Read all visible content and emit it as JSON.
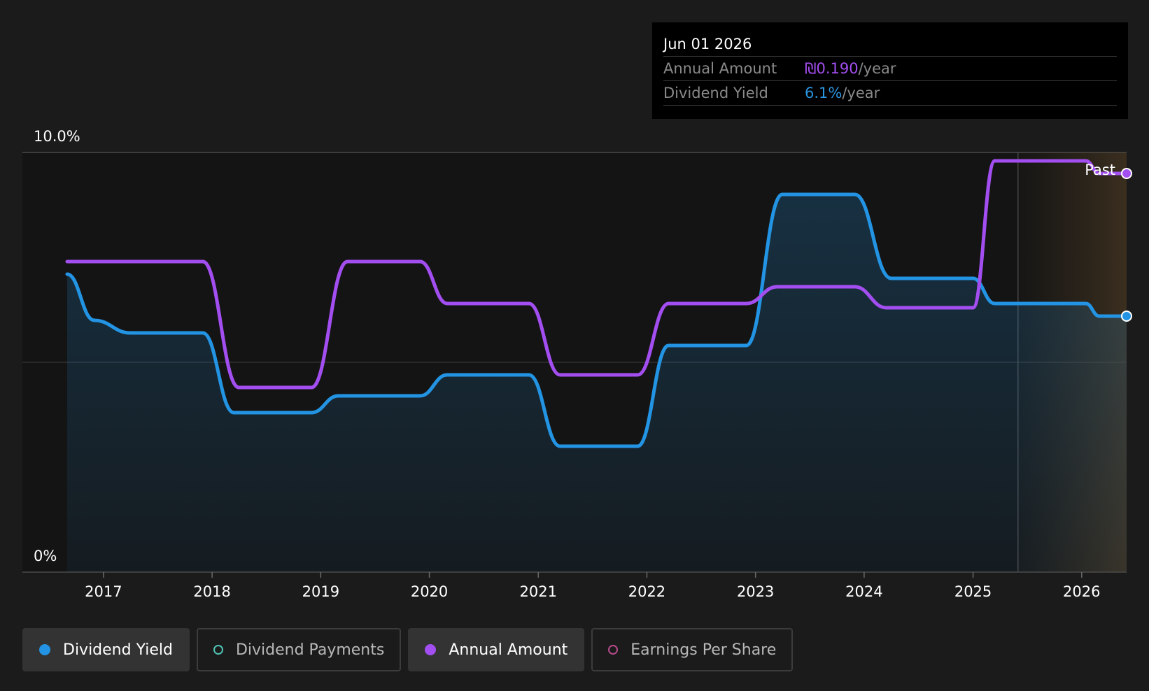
{
  "tooltip": {
    "date": "Jun 01 2026",
    "rows": [
      {
        "label": "Annual Amount",
        "value": "₪0.190",
        "unit": "/year",
        "color": "#a34ef0"
      },
      {
        "label": "Dividend Yield",
        "value": "6.1%",
        "unit": "/year",
        "color": "#2b95e0"
      }
    ]
  },
  "legend": [
    {
      "label": "Dividend Yield",
      "color": "#2394e3",
      "style": "filled",
      "active": true
    },
    {
      "label": "Dividend Payments",
      "color": "#4fc4b3",
      "style": "ring",
      "active": false
    },
    {
      "label": "Annual Amount",
      "color": "#a34ef0",
      "style": "filled",
      "active": true
    },
    {
      "label": "Earnings Per Share",
      "color": "#b54a8c",
      "style": "ring",
      "active": false
    }
  ],
  "colors": {
    "yield": "#2394e3",
    "annual": "#a34ef0",
    "past_region": "#3a3022"
  },
  "chart_data": {
    "type": "line",
    "y_labels": [
      "10.0%",
      "0%"
    ],
    "ylim": [
      0,
      10
    ],
    "x_range": [
      "2016-09-01",
      "2026-06-01"
    ],
    "x_ticks": [
      "2017",
      "2018",
      "2019",
      "2020",
      "2021",
      "2022",
      "2023",
      "2024",
      "2025",
      "2026"
    ],
    "past_label": "Past",
    "past_start": "2025-06-01",
    "gridline_values": [
      0,
      5,
      10
    ],
    "series": [
      {
        "name": "Dividend Yield",
        "points": [
          [
            "2016-09-01",
            7.1
          ],
          [
            "2016-12-01",
            6.0
          ],
          [
            "2017-04-01",
            5.7
          ],
          [
            "2017-12-01",
            5.7
          ],
          [
            "2018-03-15",
            3.8
          ],
          [
            "2018-12-01",
            3.8
          ],
          [
            "2019-03-01",
            4.2
          ],
          [
            "2019-12-01",
            4.2
          ],
          [
            "2020-03-01",
            4.7
          ],
          [
            "2020-12-01",
            4.7
          ],
          [
            "2021-03-15",
            3.0
          ],
          [
            "2021-12-01",
            3.0
          ],
          [
            "2022-03-15",
            5.4
          ],
          [
            "2022-12-01",
            5.4
          ],
          [
            "2023-04-01",
            9.0
          ],
          [
            "2023-12-01",
            9.0
          ],
          [
            "2024-04-01",
            7.0
          ],
          [
            "2025-01-01",
            7.0
          ],
          [
            "2025-03-15",
            6.4
          ],
          [
            "2026-01-15",
            6.4
          ],
          [
            "2026-03-01",
            6.1
          ],
          [
            "2026-06-01",
            6.1
          ]
        ]
      },
      {
        "name": "Annual Amount",
        "points": [
          [
            "2016-09-01",
            7.4
          ],
          [
            "2017-12-01",
            7.4
          ],
          [
            "2018-04-01",
            4.4
          ],
          [
            "2018-12-01",
            4.4
          ],
          [
            "2019-04-01",
            7.4
          ],
          [
            "2019-12-01",
            7.4
          ],
          [
            "2020-03-01",
            6.4
          ],
          [
            "2020-12-01",
            6.4
          ],
          [
            "2021-03-15",
            4.7
          ],
          [
            "2021-12-01",
            4.7
          ],
          [
            "2022-03-15",
            6.4
          ],
          [
            "2022-12-01",
            6.4
          ],
          [
            "2023-03-15",
            6.8
          ],
          [
            "2023-12-01",
            6.8
          ],
          [
            "2024-03-15",
            6.3
          ],
          [
            "2025-01-01",
            6.3
          ],
          [
            "2025-03-15",
            9.8
          ],
          [
            "2026-01-15",
            9.8
          ],
          [
            "2026-03-01",
            9.5
          ],
          [
            "2026-06-01",
            9.5
          ]
        ]
      }
    ]
  }
}
